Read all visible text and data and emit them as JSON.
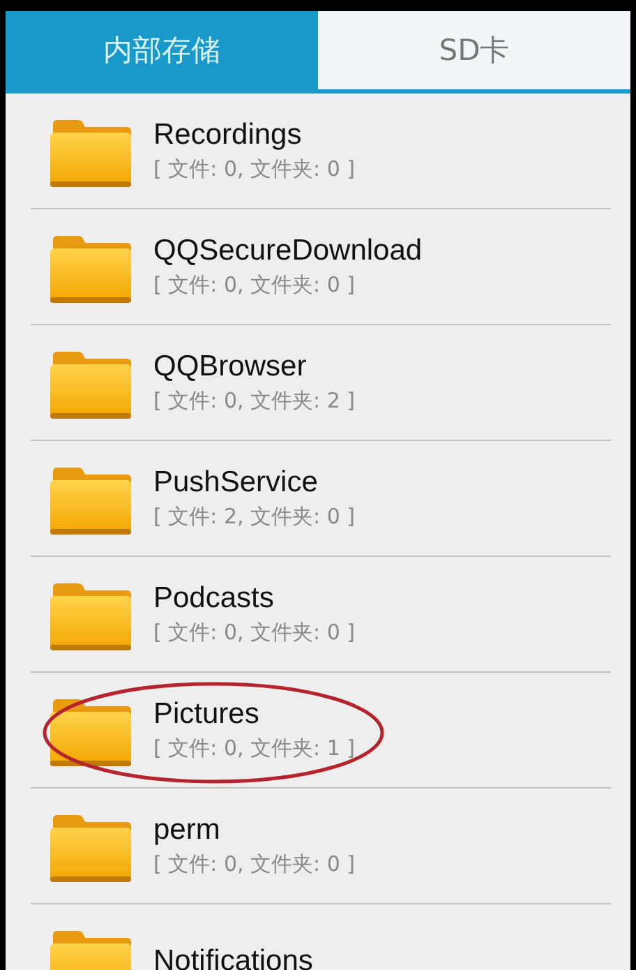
{
  "tabs": [
    {
      "label": "内部存储",
      "selected": true
    },
    {
      "label": "SD卡",
      "selected": false
    }
  ],
  "folders": [
    {
      "name": "Recordings",
      "info": "[ 文件: 0, 文件夹: 0 ]",
      "circled": false
    },
    {
      "name": "QQSecureDownload",
      "info": "[ 文件: 0, 文件夹: 0 ]",
      "circled": false
    },
    {
      "name": "QQBrowser",
      "info": "[ 文件: 0, 文件夹: 2 ]",
      "circled": false
    },
    {
      "name": "PushService",
      "info": "[ 文件: 2, 文件夹: 0 ]",
      "circled": false
    },
    {
      "name": "Podcasts",
      "info": "[ 文件: 0, 文件夹: 0 ]",
      "circled": false
    },
    {
      "name": "Pictures",
      "info": "[ 文件: 0, 文件夹: 1 ]",
      "circled": true
    },
    {
      "name": "perm",
      "info": "[ 文件: 0, 文件夹: 0 ]",
      "circled": false
    },
    {
      "name": "Notifications",
      "circled": false
    }
  ]
}
